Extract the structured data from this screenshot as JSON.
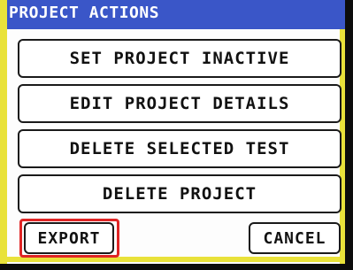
{
  "window": {
    "title": "PROJECT ACTIONS"
  },
  "actions": [
    {
      "label": "SET PROJECT INACTIVE"
    },
    {
      "label": "EDIT PROJECT DETAILS"
    },
    {
      "label": "DELETE SELECTED TEST"
    },
    {
      "label": "DELETE PROJECT"
    }
  ],
  "footer": {
    "export_label": "EXPORT",
    "cancel_label": "CANCEL"
  },
  "colors": {
    "title_bar": "#3a56c8",
    "frame": "#e9e23a",
    "highlight": "#e02525"
  }
}
